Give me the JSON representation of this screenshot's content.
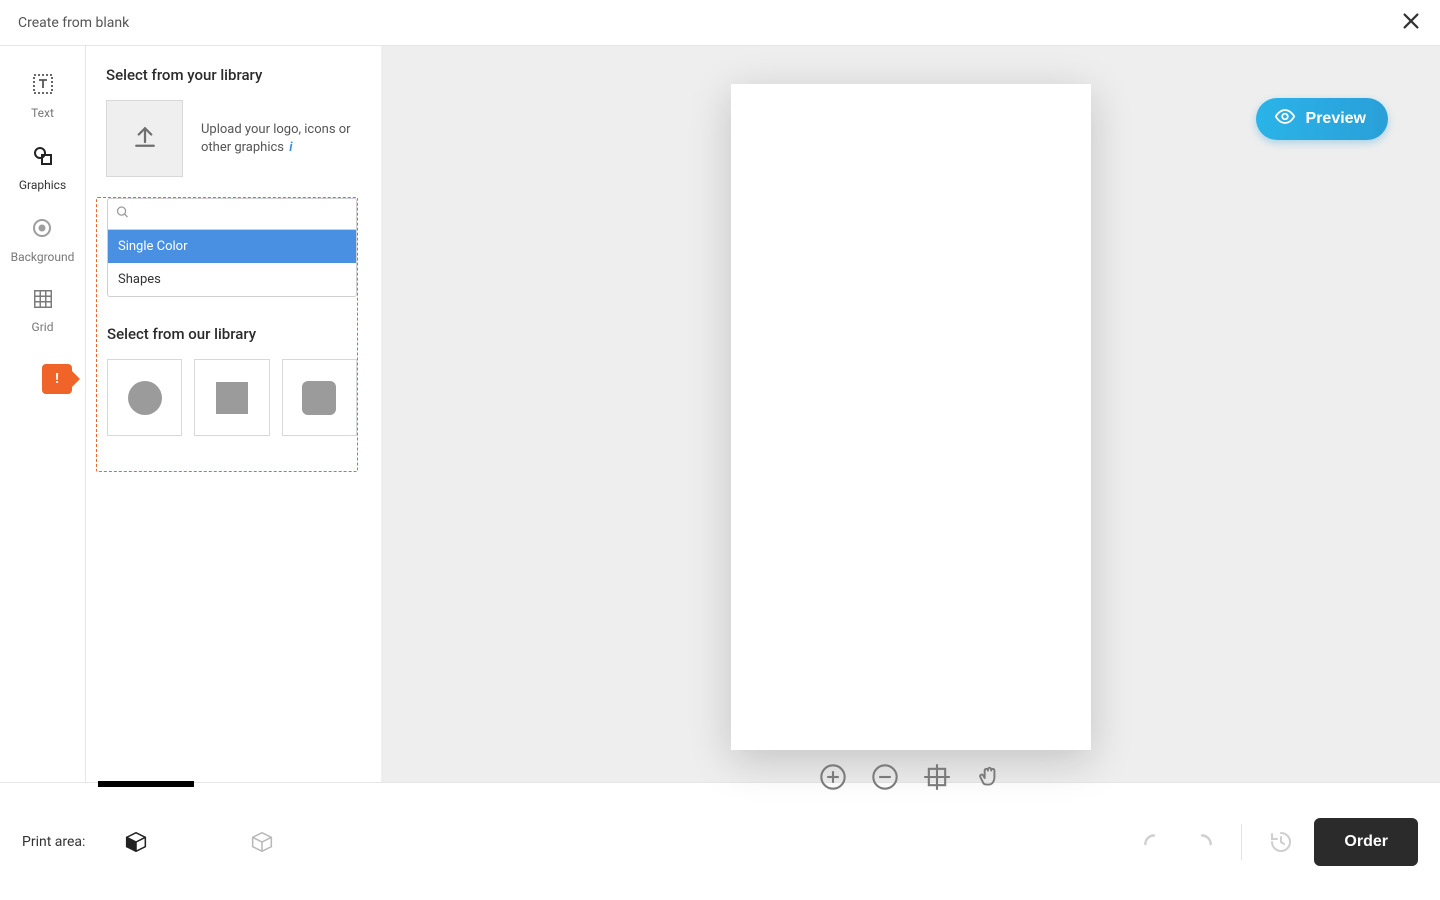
{
  "header": {
    "title": "Create from blank"
  },
  "rail": {
    "items": [
      {
        "label": "Text"
      },
      {
        "label": "Graphics"
      },
      {
        "label": "Background"
      },
      {
        "label": "Grid"
      }
    ],
    "notice": "!"
  },
  "panel": {
    "your_library_title": "Select from your library",
    "upload_text": "Upload your logo, icons or other graphics",
    "info_glyph": "i",
    "dropdown": {
      "options": [
        "Single Color",
        "Shapes"
      ],
      "selected_index": 0
    },
    "our_library_title": "Select from our library"
  },
  "preview": {
    "label": "Preview"
  },
  "footer": {
    "print_area_label": "Print area:",
    "order_label": "Order"
  }
}
